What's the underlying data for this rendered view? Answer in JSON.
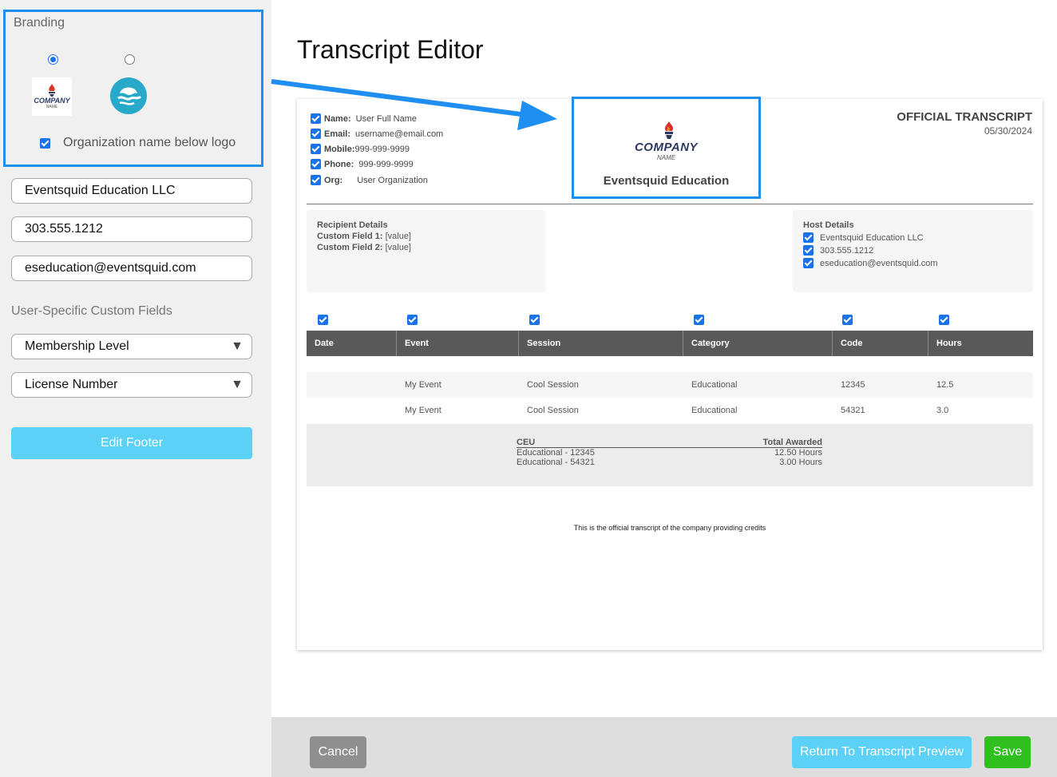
{
  "sidebar": {
    "branding_title": "Branding",
    "logo_thumb_text": "COMPANY",
    "logo_thumb_subtext": "NAME",
    "org_below_logo_label": "Organization name below logo",
    "org_name_value": "Eventsquid Education LLC",
    "phone_value": "303.555.1212",
    "email_value": "eseducation@eventsquid.com",
    "custom_fields_label": "User-Specific Custom Fields",
    "custom_field_1": "Membership Level",
    "custom_field_2": "License Number",
    "edit_footer_label": "Edit Footer"
  },
  "main": {
    "title": "Transcript Editor"
  },
  "transcript": {
    "user_fields": [
      {
        "label": "Name:",
        "value": "User Full Name"
      },
      {
        "label": "Email:",
        "value": "username@email.com"
      },
      {
        "label": "Mobile:",
        "value": "999-999-9999"
      },
      {
        "label": "Phone:",
        "value": "999-999-9999"
      },
      {
        "label": "Org:",
        "value": "User Organization"
      }
    ],
    "logo_text": "COMPANY",
    "logo_subtext": "NAME",
    "org_name": "Eventsquid Education",
    "official_title": "OFFICIAL TRANSCRIPT",
    "date": "05/30/2024",
    "recipient": {
      "title": "Recipient Details",
      "fields": [
        {
          "label": "Custom Field 1:",
          "value": "[value]"
        },
        {
          "label": "Custom Field 2:",
          "value": "[value]"
        }
      ]
    },
    "host": {
      "title": "Host Details",
      "items": [
        "Eventsquid Education LLC",
        "303.555.1212",
        "eseducation@eventsquid.com"
      ]
    },
    "columns": [
      "Date",
      "Event",
      "Session",
      "Category",
      "Code",
      "Hours"
    ],
    "rows": [
      {
        "date": "",
        "event": "My Event",
        "session": "Cool Session",
        "category": "Educational",
        "code": "12345",
        "hours": "12.5"
      },
      {
        "date": "",
        "event": "My Event",
        "session": "Cool Session",
        "category": "Educational",
        "code": "54321",
        "hours": "3.0"
      }
    ],
    "ceu": {
      "col1": "CEU",
      "col2": "Total Awarded",
      "rows": [
        {
          "name": "Educational - 12345",
          "total": "12.50 Hours"
        },
        {
          "name": "Educational - 54321",
          "total": "3.00 Hours"
        }
      ]
    },
    "footer_note": "This is the official transcript of the company providing credits"
  },
  "buttons": {
    "cancel": "Cancel",
    "return": "Return To Transcript Preview",
    "save": "Save"
  },
  "colors": {
    "accent_blue": "#1e8ff0",
    "light_blue": "#5bd1f7",
    "save_green": "#2fbf1f",
    "cancel_gray": "#8f8f8f",
    "table_header": "#595959"
  }
}
